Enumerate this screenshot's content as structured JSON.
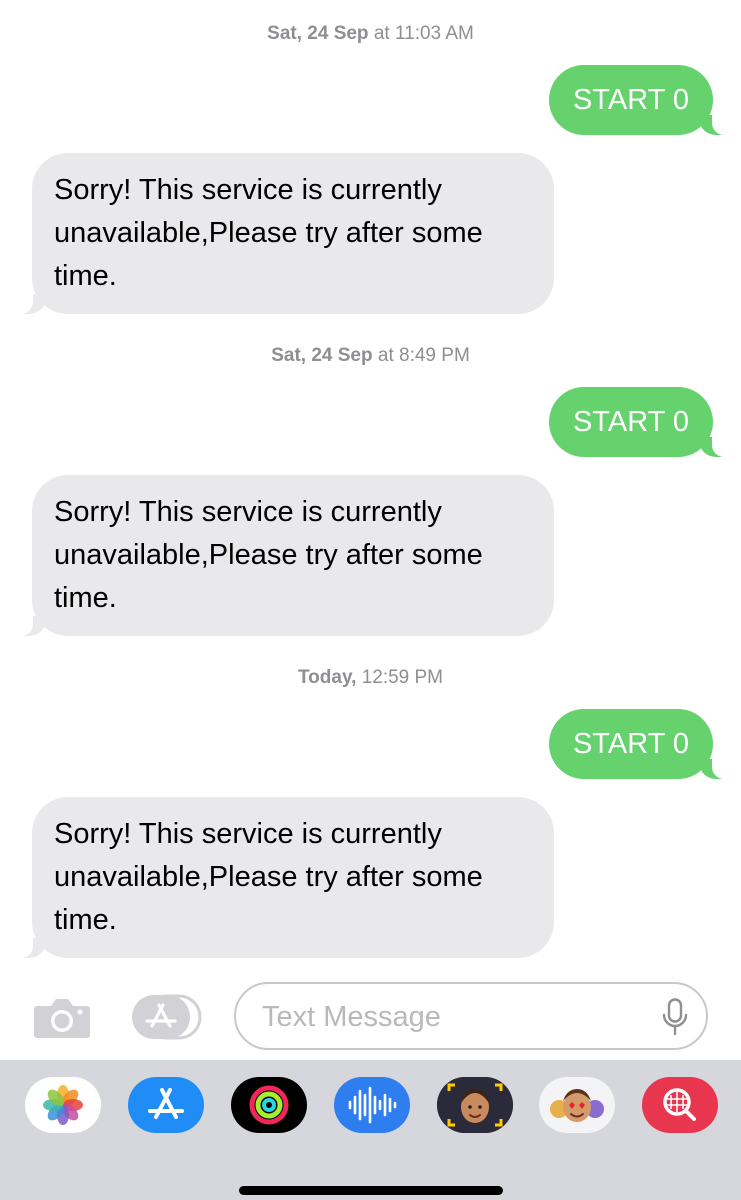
{
  "messages": [
    {
      "timestamp": {
        "day": "Sat, 24 Sep",
        "at": "at",
        "time": "11:03 AM"
      },
      "sent": "START 0",
      "received": "Sorry! This service is currently unavailable,Please try after some time."
    },
    {
      "timestamp": {
        "day": "Sat, 24 Sep",
        "at": "at",
        "time": "8:49 PM"
      },
      "sent": "START 0",
      "received": "Sorry! This service is currently unavailable,Please try after some time."
    },
    {
      "timestamp": {
        "day": "Today,",
        "at": "",
        "time": "12:59 PM"
      },
      "sent": "START 0",
      "received": "Sorry! This service is currently unavailable,Please try after some time."
    }
  ],
  "input": {
    "placeholder": "Text Message",
    "value": ""
  },
  "app_drawer": [
    {
      "name": "photos-icon"
    },
    {
      "name": "app-store-icon"
    },
    {
      "name": "fitness-activity-icon"
    },
    {
      "name": "audio-message-icon"
    },
    {
      "name": "memoji-icon"
    },
    {
      "name": "memoji-stickers-icon"
    },
    {
      "name": "web-images-search-icon"
    }
  ],
  "colors": {
    "sent_bubble": "#65d26e",
    "received_bubble": "#e9e9eb",
    "timestamp": "#8e8e93",
    "drawer_background": "#d5d7dd"
  }
}
